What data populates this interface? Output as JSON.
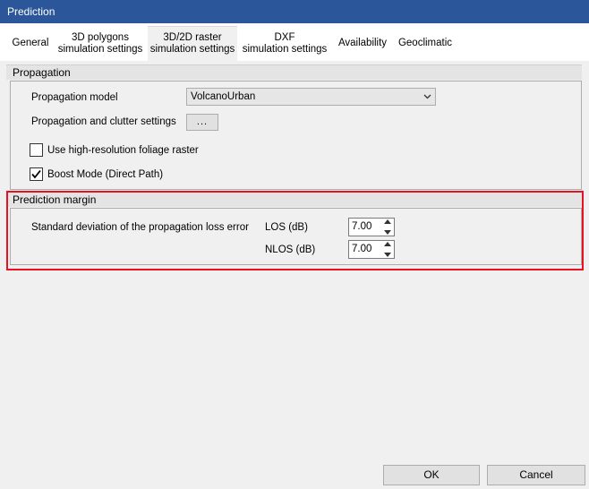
{
  "window": {
    "title": "Prediction"
  },
  "tabs": [
    {
      "label": "General"
    },
    {
      "label": "3D polygons\nsimulation settings"
    },
    {
      "label": "3D/2D raster\nsimulation settings"
    },
    {
      "label": "DXF\nsimulation settings"
    },
    {
      "label": "Availability"
    },
    {
      "label": "Geoclimatic"
    }
  ],
  "active_tab": "3D/2D raster\nsimulation settings",
  "propagation": {
    "header": "Propagation",
    "model_label": "Propagation model",
    "model_value": "VolcanoUrban",
    "clutter_label": "Propagation and clutter settings",
    "clutter_button": "...",
    "foliage_label": "Use high-resolution foliage raster",
    "foliage_checked": false,
    "boost_label": "Boost Mode (Direct Path)",
    "boost_checked": true
  },
  "prediction_margin": {
    "header": "Prediction margin",
    "std_label": "Standard deviation of the propagation loss error",
    "los_label": "LOS (dB)",
    "los_value": "7.00",
    "nlos_label": "NLOS (dB)",
    "nlos_value": "7.00"
  },
  "footer": {
    "ok_label": "OK",
    "cancel_label": "Cancel"
  },
  "colors": {
    "titlebar": "#2b579a",
    "highlight": "#e81123"
  }
}
